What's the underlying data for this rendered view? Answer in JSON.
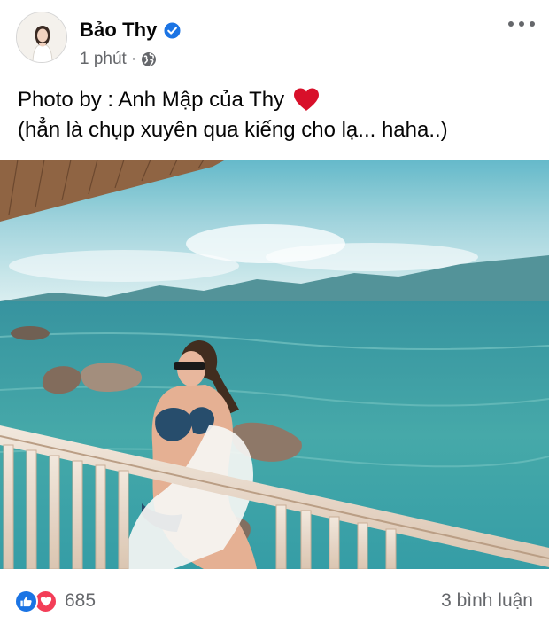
{
  "post": {
    "author": "Bảo Thy",
    "timestamp": "1 phút",
    "separator": "·",
    "privacy_icon": "globe-icon",
    "verified_icon": "verified-badge-icon",
    "menu_icon": "more-options-icon",
    "caption_line1": "Photo by : Anh Mập của Thy",
    "caption_line2": "(hẳn là chụp xuyên qua kiếng cho lạ... haha..)",
    "caption_emoji": "red-heart-icon"
  },
  "reactions": {
    "count": "685",
    "icons": [
      "like-icon",
      "love-icon"
    ]
  },
  "comments": {
    "label": "3 bình luận"
  },
  "colors": {
    "link_blue": "#1b74e4",
    "love_red": "#f33e58",
    "secondary_text": "#65676b",
    "sea": "#3fa6a6"
  }
}
